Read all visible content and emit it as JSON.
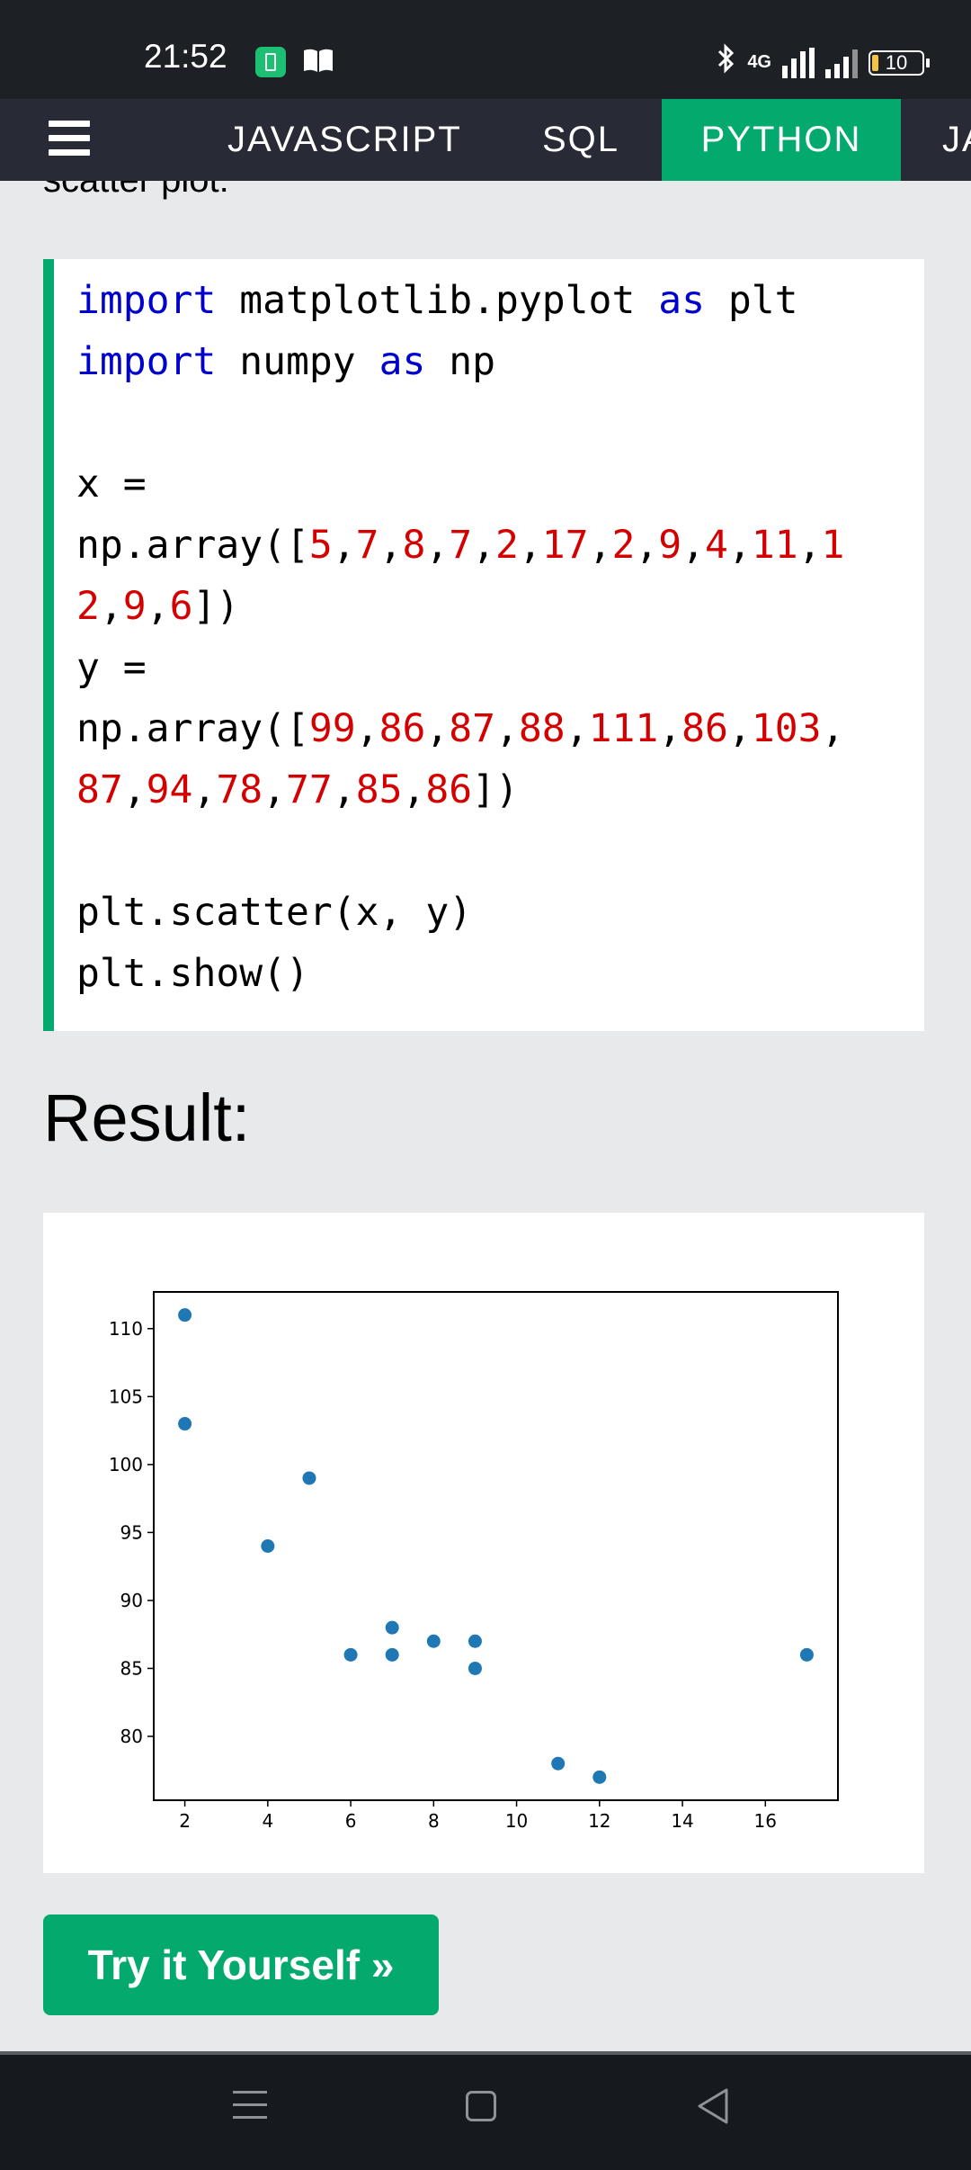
{
  "status_bar": {
    "time": "21:52",
    "network": "4G",
    "battery": "10",
    "icons": [
      "battery-app-icon",
      "book-icon",
      "bluetooth-icon",
      "signal-icon",
      "battery-icon"
    ]
  },
  "nav": {
    "tabs": [
      {
        "label": "JAVASCRIPT"
      },
      {
        "label": "SQL"
      },
      {
        "label": "PYTHON",
        "active": true
      },
      {
        "label": "JA"
      }
    ],
    "active_color": "#04aa6d"
  },
  "partial_text": "scatter plot:",
  "code_lines": [
    [
      {
        "t": "import",
        "c": "kw"
      },
      {
        "t": " matplotlib.pyplot "
      },
      {
        "t": "as",
        "c": "kw"
      },
      {
        "t": " plt"
      }
    ],
    [
      {
        "t": "import",
        "c": "kw"
      },
      {
        "t": " numpy "
      },
      {
        "t": "as",
        "c": "kw"
      },
      {
        "t": " np"
      }
    ],
    [],
    [
      {
        "t": "x ="
      }
    ],
    [
      {
        "t": "np.array(["
      },
      {
        "t": "5",
        "c": "num"
      },
      {
        "t": ","
      },
      {
        "t": "7",
        "c": "num"
      },
      {
        "t": ","
      },
      {
        "t": "8",
        "c": "num"
      },
      {
        "t": ","
      },
      {
        "t": "7",
        "c": "num"
      },
      {
        "t": ","
      },
      {
        "t": "2",
        "c": "num"
      },
      {
        "t": ","
      },
      {
        "t": "17",
        "c": "num"
      },
      {
        "t": ","
      },
      {
        "t": "2",
        "c": "num"
      },
      {
        "t": ","
      },
      {
        "t": "9",
        "c": "num"
      },
      {
        "t": ","
      },
      {
        "t": "4",
        "c": "num"
      },
      {
        "t": ","
      },
      {
        "t": "11",
        "c": "num"
      },
      {
        "t": ","
      },
      {
        "t": "1",
        "c": "num"
      }
    ],
    [
      {
        "t": "2",
        "c": "num"
      },
      {
        "t": ","
      },
      {
        "t": "9",
        "c": "num"
      },
      {
        "t": ","
      },
      {
        "t": "6",
        "c": "num"
      },
      {
        "t": "])"
      }
    ],
    [
      {
        "t": "y ="
      }
    ],
    [
      {
        "t": "np.array(["
      },
      {
        "t": "99",
        "c": "num"
      },
      {
        "t": ","
      },
      {
        "t": "86",
        "c": "num"
      },
      {
        "t": ","
      },
      {
        "t": "87",
        "c": "num"
      },
      {
        "t": ","
      },
      {
        "t": "88",
        "c": "num"
      },
      {
        "t": ","
      },
      {
        "t": "111",
        "c": "num"
      },
      {
        "t": ","
      },
      {
        "t": "86",
        "c": "num"
      },
      {
        "t": ","
      },
      {
        "t": "103",
        "c": "num"
      },
      {
        "t": ","
      }
    ],
    [
      {
        "t": "87",
        "c": "num"
      },
      {
        "t": ","
      },
      {
        "t": "94",
        "c": "num"
      },
      {
        "t": ","
      },
      {
        "t": "78",
        "c": "num"
      },
      {
        "t": ","
      },
      {
        "t": "77",
        "c": "num"
      },
      {
        "t": ","
      },
      {
        "t": "85",
        "c": "num"
      },
      {
        "t": ","
      },
      {
        "t": "86",
        "c": "num"
      },
      {
        "t": "])"
      }
    ],
    [],
    [
      {
        "t": "plt.scatter(x, y)"
      }
    ],
    [
      {
        "t": "plt.show()"
      }
    ]
  ],
  "result_title": "Result:",
  "chart_data": {
    "type": "scatter",
    "x": [
      5,
      7,
      8,
      7,
      2,
      17,
      2,
      9,
      4,
      11,
      12,
      9,
      6
    ],
    "y": [
      99,
      86,
      87,
      88,
      111,
      86,
      103,
      87,
      94,
      78,
      77,
      85,
      86
    ],
    "xlim": [
      1.25,
      17.75
    ],
    "ylim": [
      75.3,
      112.7
    ],
    "xticks": [
      2,
      4,
      6,
      8,
      10,
      12,
      14,
      16
    ],
    "yticks": [
      80,
      85,
      90,
      95,
      100,
      105,
      110
    ],
    "grid": false,
    "color": "#1f77b4"
  },
  "try_button": "Try it Yourself »"
}
